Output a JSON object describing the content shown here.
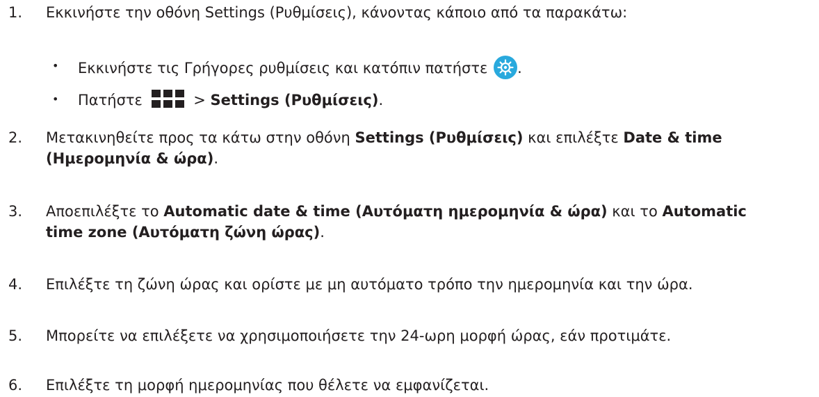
{
  "steps": [
    {
      "num": "1.",
      "parts": [
        "Εκκινήστε την οθόνη Settings (Ρυθμίσεις), κάνοντας κάποιο από τα παρακάτω:"
      ],
      "subitems": [
        {
          "bullet": "•",
          "text_before": "Εκκινήστε τις Γρήγορες ρυθμίσεις και κατόπιν πατήστε",
          "icon": "gear-icon",
          "text_after": "."
        },
        {
          "bullet": "•",
          "text_before": "Πατήστε",
          "icon": "apps-grid-icon",
          "text_after": " > ",
          "bold": "Settings (Ρυθμίσεις)",
          "text_end": "."
        }
      ]
    },
    {
      "num": "2.",
      "line1_a": "Μετακινηθείτε προς τα κάτω στην οθόνη ",
      "line1_b": "Settings (Ρυθμίσεις)",
      "line1_c": " και επιλέξτε ",
      "line1_d": "Date & time",
      "line2_a": "(Ημερομηνία & ώρα)",
      "line2_b": "."
    },
    {
      "num": "3.",
      "line1_a": "Αποεπιλέξτε το ",
      "line1_b": "Automatic date & time (Αυτόματη ημερομηνία & ώρα)",
      "line1_c": " και το ",
      "line1_d": "Automatic",
      "line2_a": "time zone (Αυτόματη ζώνη ώρας)",
      "line2_b": "."
    },
    {
      "num": "4.",
      "text": "Επιλέξτε τη ζώνη ώρας και ορίστε με μη αυτόματο τρόπο την ημερομηνία και την ώρα."
    },
    {
      "num": "5.",
      "text": "Μπορείτε να επιλέξετε να χρησιμοποιήσετε την 24-ωρη μορφή ώρας, εάν προτιμάτε."
    },
    {
      "num": "6.",
      "text": "Επιλέξτε τη μορφή ημερομηνίας που θέλετε να εμφανίζεται."
    }
  ],
  "colors": {
    "text": "#231f20",
    "gear_bg": "#29a9dd",
    "icon_dark": "#231f20"
  }
}
